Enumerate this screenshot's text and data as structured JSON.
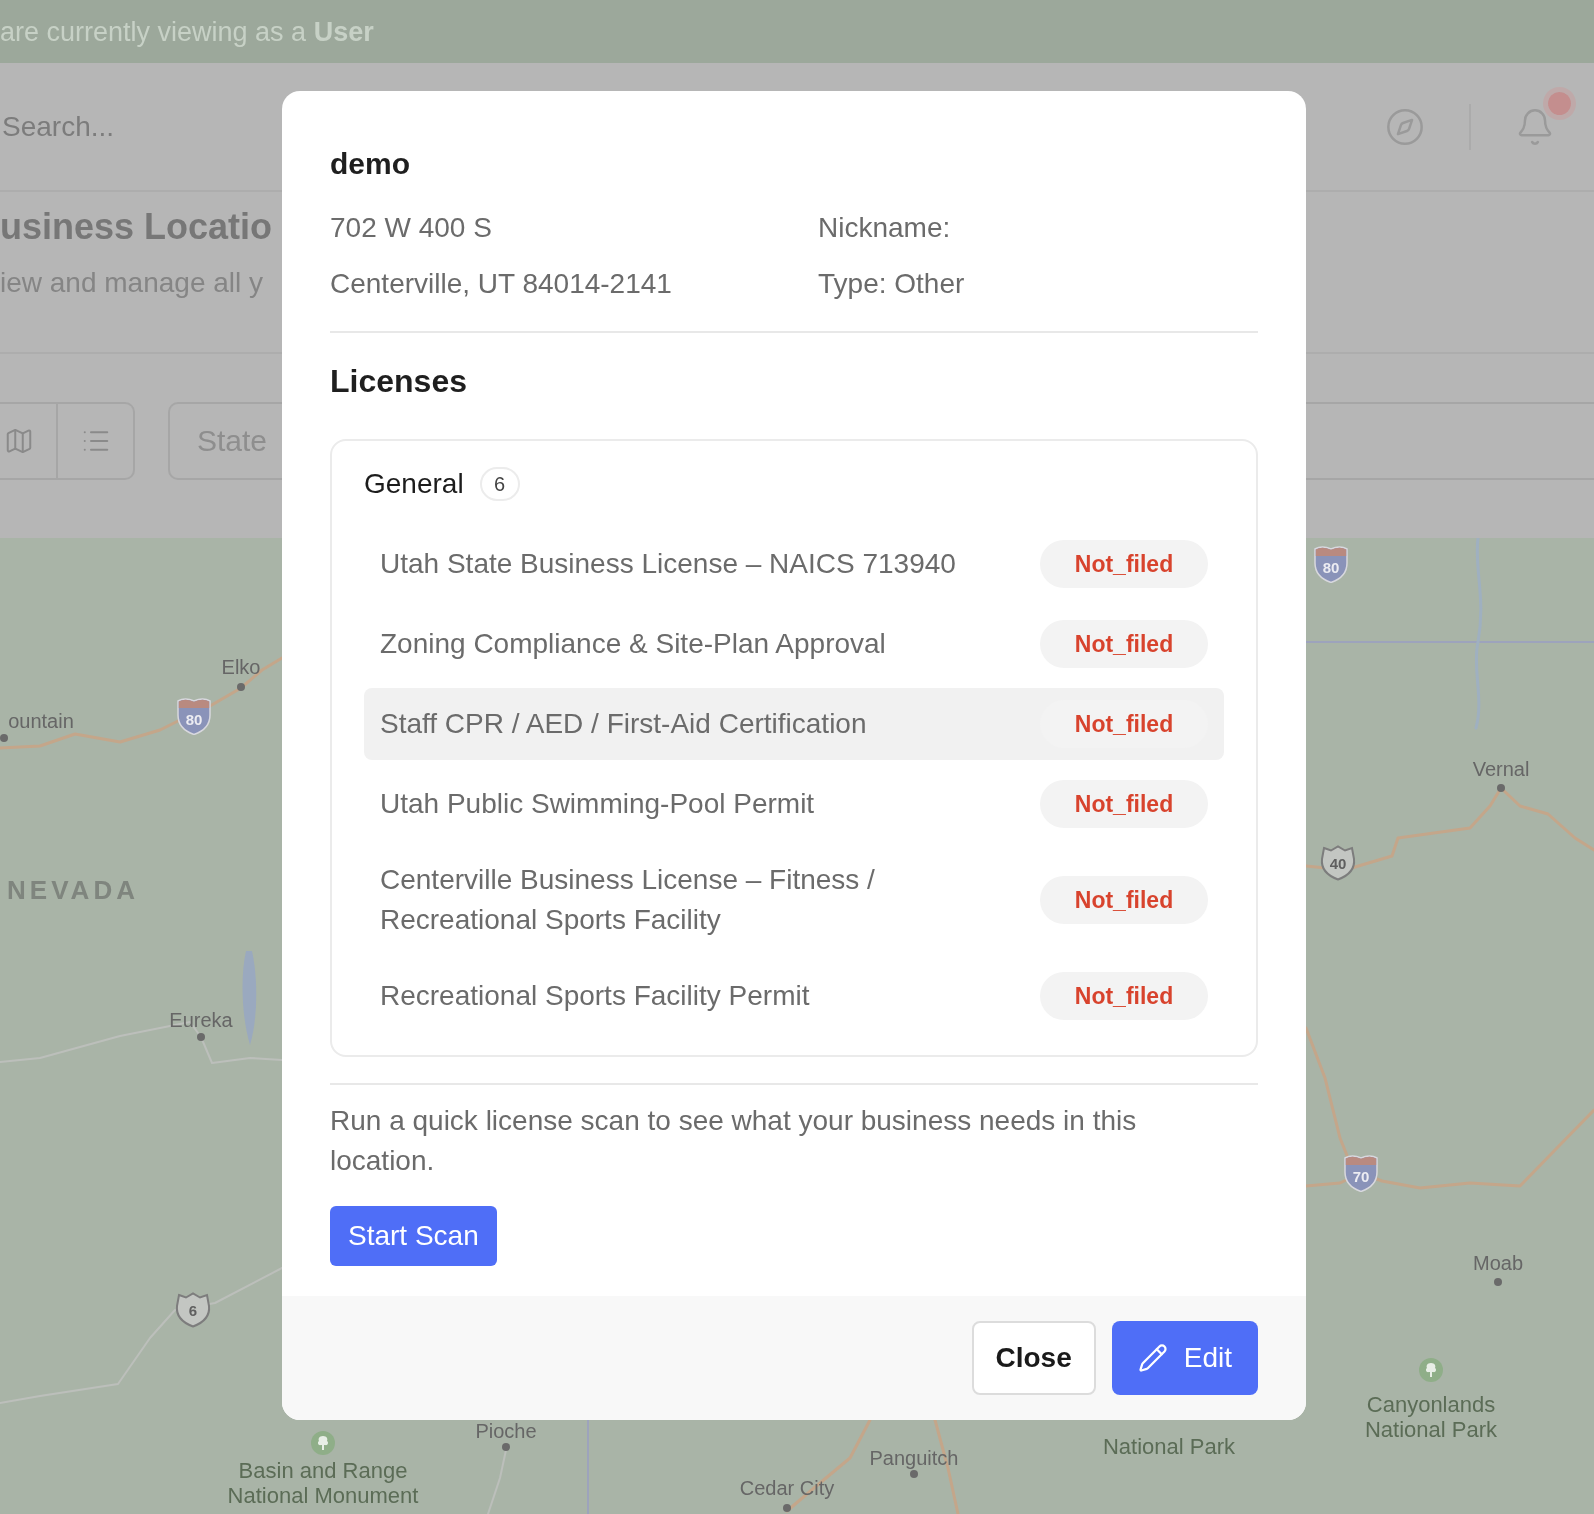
{
  "banner": {
    "text": "are currently viewing as a **User**"
  },
  "header": {
    "search": {
      "placeholder": "Search..."
    },
    "notifications": {
      "unread": true
    }
  },
  "page_header": {
    "title": "usiness Locatio",
    "subtitle": "iew and manage all y"
  },
  "filters": {
    "state": {
      "placeholder": "State"
    }
  },
  "map": {
    "labels": [
      {
        "text": "Elko",
        "kind": "city"
      },
      {
        "text": "ountain",
        "kind": "city"
      },
      {
        "text": "NEVADA",
        "kind": "region"
      },
      {
        "text": "Eureka",
        "kind": "city"
      },
      {
        "text": "Pioche",
        "kind": "city"
      },
      {
        "text": "Basin and Range National Monument",
        "kind": "park"
      },
      {
        "text": "Panguitch",
        "kind": "city"
      },
      {
        "text": "Cedar City",
        "kind": "city"
      },
      {
        "text": "National Park",
        "kind": "park_label"
      },
      {
        "text": "Vernal",
        "kind": "city"
      },
      {
        "text": "Moab",
        "kind": "city"
      },
      {
        "text": "Canyonlands National Park",
        "kind": "park"
      }
    ],
    "shields": [
      {
        "number": "80",
        "kind": "interstate"
      },
      {
        "number": "6",
        "kind": "us"
      },
      {
        "number": "80",
        "kind": "interstate"
      },
      {
        "number": "40",
        "kind": "us"
      },
      {
        "number": "70",
        "kind": "interstate"
      }
    ]
  },
  "modal": {
    "title": "demo",
    "address_lines": [
      "702 W 400 S",
      "Centerville, UT 84014-2141"
    ],
    "details": [
      "Nickname:",
      "Type: Other"
    ],
    "licenses_heading": "Licenses",
    "groups": [
      {
        "name": "General",
        "count": "6",
        "licenses": [
          {
            "name": "Utah State Business License – NAICS 713940",
            "status": "Not_filed",
            "highlighted": false
          },
          {
            "name": "Zoning Compliance & Site-Plan Approval",
            "status": "Not_filed",
            "highlighted": false
          },
          {
            "name": "Staff CPR / AED / First-Aid Certification",
            "status": "Not_filed",
            "highlighted": true
          },
          {
            "name": "Utah Public Swimming-Pool Permit",
            "status": "Not_filed",
            "highlighted": false
          },
          {
            "name": "Centerville Business License – Fitness / Recreational Sports Facility",
            "status": "Not_filed",
            "highlighted": false
          },
          {
            "name": "Recreational Sports Facility Permit",
            "status": "Not_filed",
            "highlighted": false
          }
        ]
      }
    ],
    "scan_prompt": "Run a quick license scan to see what your business needs in this location.",
    "scan_button": "Start Scan",
    "buttons": [
      {
        "label": "Close",
        "kind": "secondary",
        "icon": false
      },
      {
        "label": "Edit",
        "kind": "primary",
        "icon": true
      }
    ]
  }
}
